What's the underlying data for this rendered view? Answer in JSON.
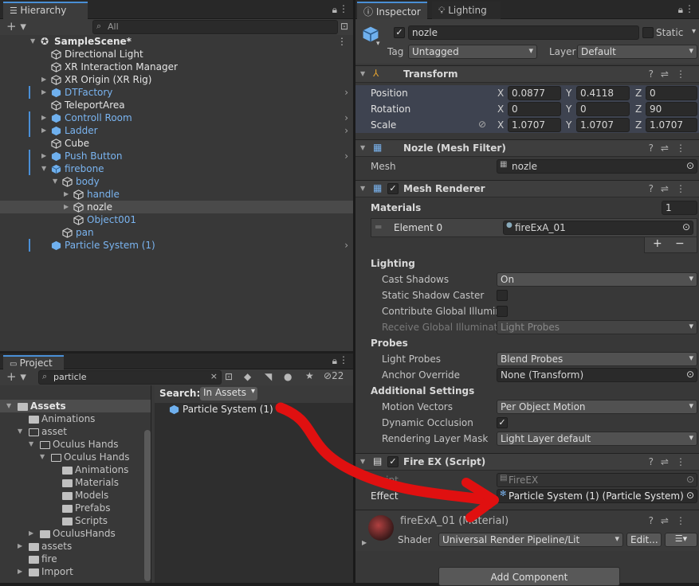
{
  "hierarchy": {
    "tab": "Hierarchy",
    "search_placeholder": "All",
    "scene": "SampleScene*",
    "items": [
      {
        "label": "Directional Light",
        "color": "white"
      },
      {
        "label": "XR Interaction Manager",
        "color": "white"
      },
      {
        "label": "XR Origin (XR Rig)",
        "color": "white"
      },
      {
        "label": "DTFactory",
        "color": "blue"
      },
      {
        "label": "TeleportArea",
        "color": "white"
      },
      {
        "label": "Controll Room",
        "color": "blue"
      },
      {
        "label": "Ladder",
        "color": "blue"
      },
      {
        "label": "Cube",
        "color": "white"
      },
      {
        "label": "Push Button",
        "color": "blue"
      },
      {
        "label": "firebone",
        "color": "blue"
      },
      {
        "label": "body",
        "color": "blue"
      },
      {
        "label": "handle",
        "color": "blue"
      },
      {
        "label": "nozle",
        "color": "white"
      },
      {
        "label": "Object001",
        "color": "blue"
      },
      {
        "label": "pan",
        "color": "blue"
      },
      {
        "label": "Particle System (1)",
        "color": "blue"
      }
    ]
  },
  "project": {
    "tab": "Project",
    "search_value": "particle",
    "hidden_count": "22",
    "search_label": "Search:",
    "search_scope": "In Assets",
    "result": "Particle System (1)",
    "tree": [
      {
        "label": "Assets",
        "bold": true
      },
      {
        "label": "Animations"
      },
      {
        "label": "asset"
      },
      {
        "label": "Oculus Hands"
      },
      {
        "label": "Oculus Hands"
      },
      {
        "label": "Animations"
      },
      {
        "label": "Materials"
      },
      {
        "label": "Models"
      },
      {
        "label": "Prefabs"
      },
      {
        "label": "Scripts"
      },
      {
        "label": "OculusHands"
      },
      {
        "label": "assets"
      },
      {
        "label": "fire"
      },
      {
        "label": "Import"
      }
    ]
  },
  "inspector": {
    "tab": "Inspector",
    "tab2": "Lighting",
    "object_name": "nozle",
    "static_label": "Static",
    "tag_label": "Tag",
    "tag_value": "Untagged",
    "layer_label": "Layer",
    "layer_value": "Default",
    "transform": {
      "title": "Transform",
      "position_label": "Position",
      "rotation_label": "Rotation",
      "scale_label": "Scale",
      "position": {
        "x": "0.0877",
        "y": "0.4118",
        "z": "0"
      },
      "rotation": {
        "x": "0",
        "y": "0",
        "z": "90"
      },
      "scale": {
        "x": "1.0707",
        "y": "1.0707",
        "z": "1.0707"
      },
      "axis_x": "X",
      "axis_y": "Y",
      "axis_z": "Z"
    },
    "mesh_filter": {
      "title": "Nozle (Mesh Filter)",
      "mesh_label": "Mesh",
      "mesh_value": "nozle"
    },
    "mesh_renderer": {
      "title": "Mesh Renderer",
      "materials_label": "Materials",
      "materials_count": "1",
      "element_label": "Element 0",
      "element_value": "fireExA_01",
      "lighting_label": "Lighting",
      "cast_shadows_label": "Cast Shadows",
      "cast_shadows_value": "On",
      "static_shadow_label": "Static Shadow Caster",
      "contrib_gi_label": "Contribute Global Illumina",
      "receive_gi_label": "Receive Global Illuminatio",
      "receive_gi_value": "Light Probes",
      "probes_label": "Probes",
      "light_probes_label": "Light Probes",
      "light_probes_value": "Blend Probes",
      "anchor_label": "Anchor Override",
      "anchor_value": "None (Transform)",
      "additional_label": "Additional Settings",
      "motion_label": "Motion Vectors",
      "motion_value": "Per Object Motion",
      "dyn_occ_label": "Dynamic Occlusion",
      "rlm_label": "Rendering Layer Mask",
      "rlm_value": "Light Layer default"
    },
    "script": {
      "title": "Fire EX (Script)",
      "script_label": "Script",
      "script_value": "FireEX",
      "effect_label": "Effect",
      "effect_value": "Particle System (1) (Particle System)"
    },
    "material": {
      "name": "fireExA_01 (Material)",
      "shader_label": "Shader",
      "shader_value": "Universal Render Pipeline/Lit",
      "edit_label": "Edit..."
    },
    "add_component": "Add Component"
  },
  "colors": {
    "accent": "#4a8fd6",
    "prefab_blue": "#7ab4f0",
    "annotation_red": "#e01010"
  }
}
